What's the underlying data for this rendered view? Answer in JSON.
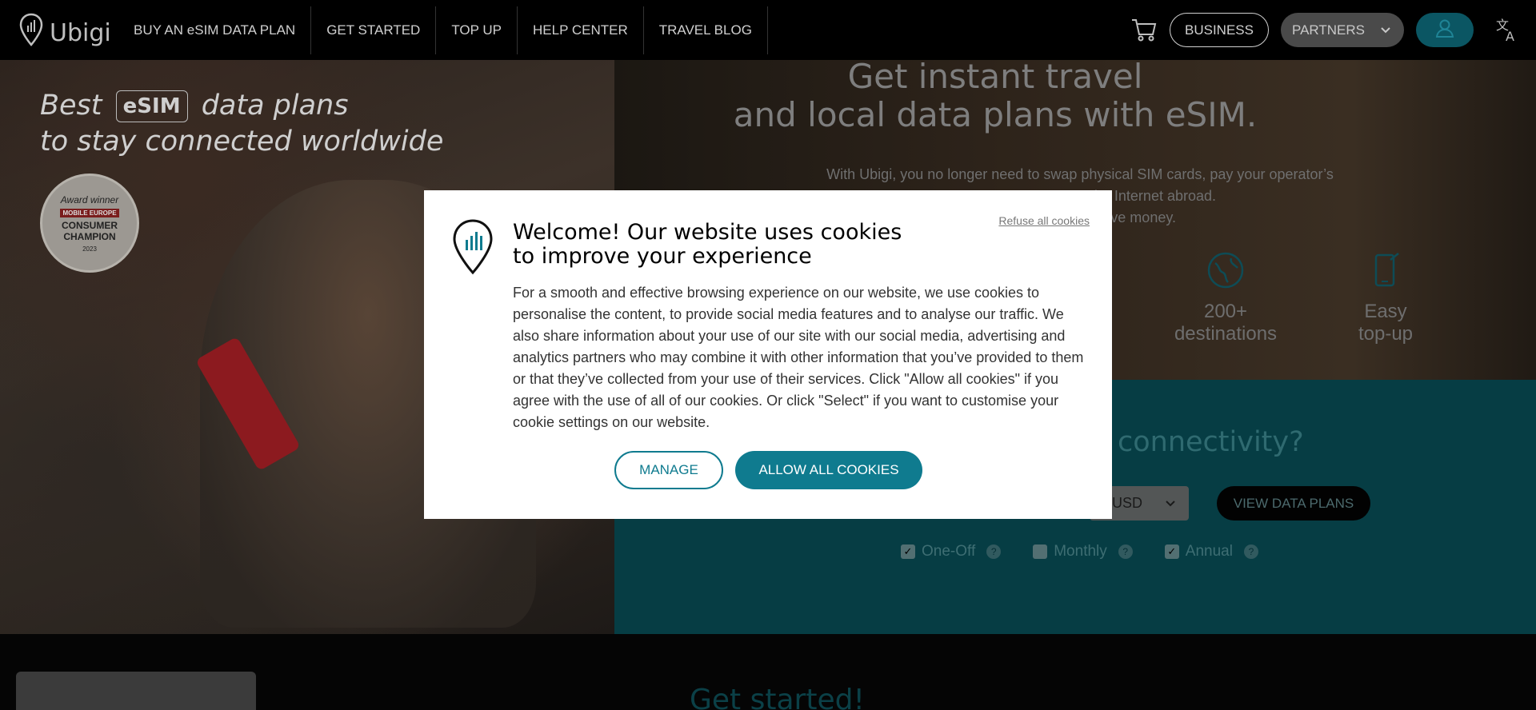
{
  "nav": {
    "logo": "Ubigi",
    "links": [
      "BUY AN eSIM DATA PLAN",
      "GET STARTED",
      "TOP UP",
      "HELP CENTER",
      "TRAVEL BLOG"
    ],
    "business_label": "BUSINESS",
    "partners_label": "PARTNERS"
  },
  "hero": {
    "tagline_pre": "Best",
    "tagline_badge": "eSIM",
    "tagline_post": "data plans",
    "tagline_line2": "to stay connected worldwide",
    "award": {
      "line1": "Award winner",
      "line2": "MOBILE EUROPE",
      "line3": "CONSUMER",
      "line4": "CHAMPION",
      "year": "2023"
    },
    "title_line1": "Get instant travel",
    "title_line2": "and local data plans with eSIM.",
    "description_line1": "With Ubigi, you no longer need to swap physical SIM cards, pay your operator’s",
    "description_line2": "connect to the Internet abroad.",
    "description_line3": "obile data and save money.",
    "features": [
      {
        "icon": "globe-icon",
        "line1": "200+",
        "line2": "destinations"
      },
      {
        "icon": "phone-icon",
        "line1": "Easy",
        "line2": "top-up"
      }
    ]
  },
  "finder": {
    "question": "connectivity?",
    "currency": "USD",
    "view_button": "VIEW DATA PLANS",
    "options": [
      {
        "label": "One-Off",
        "checked": true
      },
      {
        "label": "Monthly",
        "checked": false
      },
      {
        "label": "Annual",
        "checked": true
      }
    ]
  },
  "section": {
    "get_started": "Get started!"
  },
  "cookie_modal": {
    "refuse_link": "Refuse all cookies",
    "title": "Welcome! Our website uses cookies to improve your experience",
    "body": "For a smooth and effective browsing experience on our website, we use cookies to personalise the content, to provide social media features and to analyse our traffic. We also share information about your use of our site with our social media, advertising and analytics partners who may combine it with other information that you’ve provided to them or that they’ve collected from your use of their services. Click \"Allow all cookies\" if you agree with the use of all of our cookies. Or click \"Select\" if you want to customise your cookie settings on our website.",
    "manage_label": "MANAGE",
    "allow_label": "ALLOW ALL COOKIES"
  },
  "colors": {
    "accent": "#0f7b8f",
    "teal_bg": "#063d44"
  }
}
